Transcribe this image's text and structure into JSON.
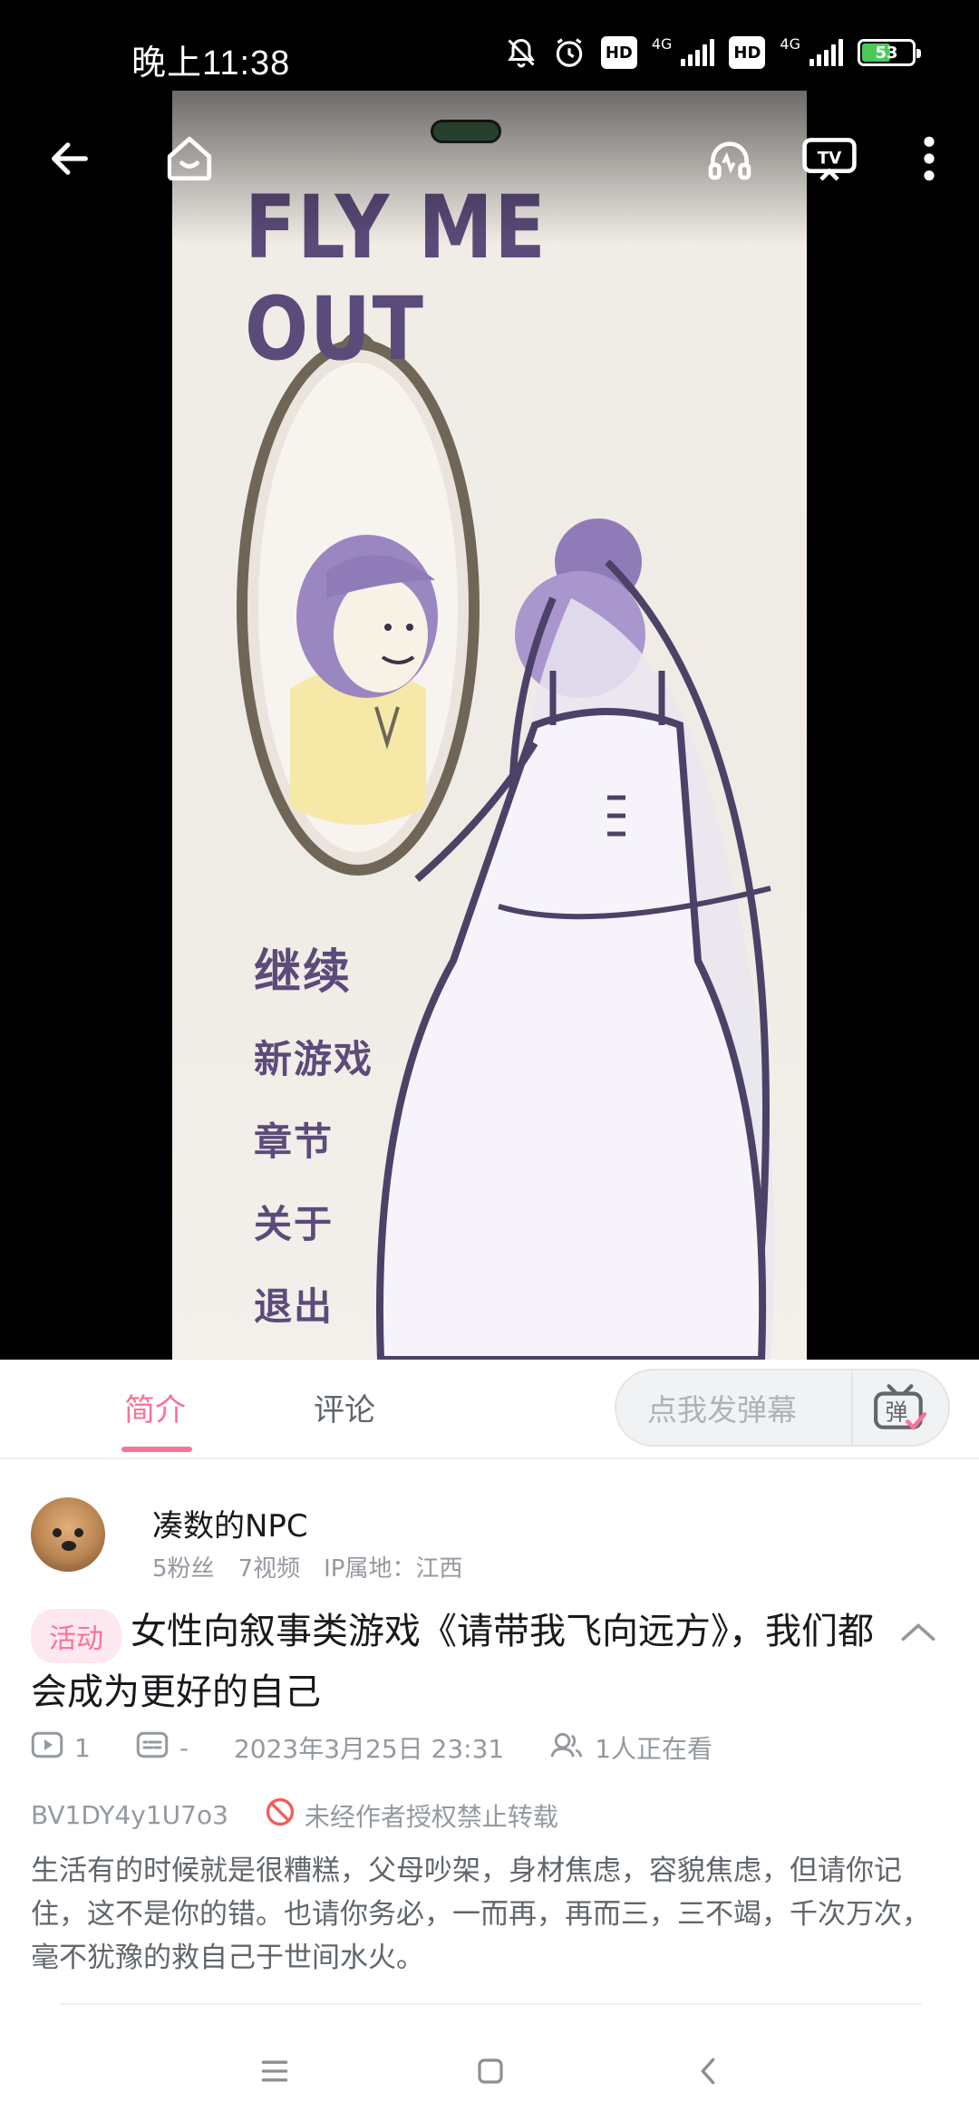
{
  "status_bar": {
    "time": "晚上11:38",
    "net_label_1": "4G",
    "net_label_2": "4G",
    "hd_label": "HD",
    "battery": "53",
    "battery_level": 0.53
  },
  "player": {
    "game_title": "FLY ME OUT",
    "menu": [
      "继续",
      "新游戏",
      "章节",
      "关于",
      "退出"
    ],
    "icons": [
      "back-arrow-icon",
      "home-icon",
      "headphones-icon",
      "tv-cast-icon",
      "more-vert-icon"
    ],
    "cast_label": "TV"
  },
  "tabs": {
    "intro": "简介",
    "comments": "评论",
    "danmaku_placeholder": "点我发弹幕",
    "danmaku_toggle_label": "弹"
  },
  "author": {
    "name": "凑数的NPC",
    "fans": "5粉丝",
    "videos": "7视频",
    "ip": "IP属地：江西"
  },
  "video": {
    "badge": "活动",
    "title": "女性向叙事类游戏《请带我飞向远方》，我们都会成为更好的自己",
    "play_count": "1",
    "danmaku_count": "-",
    "datetime": "2023年3月25日 23:31",
    "watching": "1人正在看",
    "bvid": "BV1DY4y1U7o3",
    "copyright": "未经作者授权禁止转载",
    "description": "生活有的时候就是很糟糕，父母吵架，身材焦虑，容貌焦虑，但请你记住，这不是你的错。也请你务必，一而再，再而三，三不竭，千次万次，毫不犹豫的救自己于世间水火。"
  },
  "colors": {
    "accent": "#fb7299",
    "game_purple": "#5b4b7a",
    "text_secondary": "#9499a0"
  }
}
